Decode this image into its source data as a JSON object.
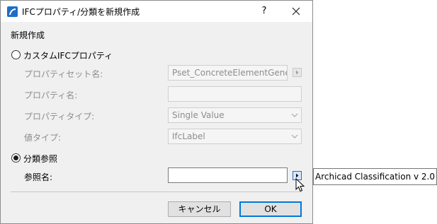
{
  "window": {
    "title": "IFCプロパティ/分類を新規作成",
    "help_label": "?"
  },
  "section_title": "新規作成",
  "custom_ifc": {
    "radio_label": "カスタムIFCプロパティ",
    "selected": false,
    "propertyset_name": {
      "label": "プロパティセット名:",
      "value": "Pset_ConcreteElementGene"
    },
    "property_name": {
      "label": "プロパティ名:",
      "value": ""
    },
    "property_type": {
      "label": "プロパティタイプ:",
      "value": "Single Value"
    },
    "value_type": {
      "label": "値タイプ:",
      "value": "IfcLabel"
    }
  },
  "classification": {
    "radio_label": "分類参照",
    "selected": true,
    "reference_name": {
      "label": "参照名:",
      "value": ""
    }
  },
  "buttons": {
    "cancel": "キャンセル",
    "ok": "OK"
  },
  "tooltip": "Archicad Classification v 2.0"
}
